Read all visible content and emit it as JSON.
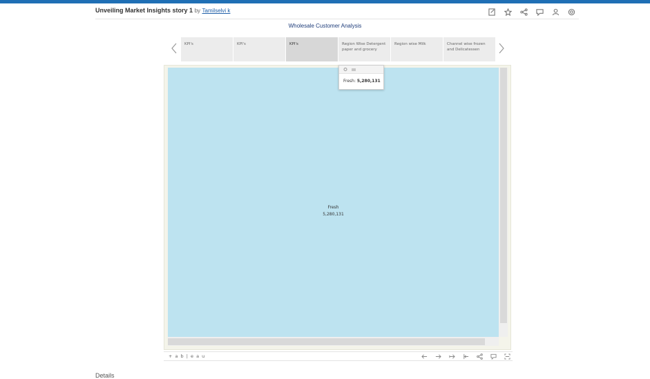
{
  "header": {
    "title": "Unveiling Market Insights story 1",
    "by": "by",
    "author": "Tamilselvi k",
    "actions": [
      "edit-icon",
      "star-icon",
      "share-icon",
      "comment-icon",
      "subscribe-icon",
      "settings-icon"
    ]
  },
  "story": {
    "title": "Wholesale Customer Analysis",
    "tabs": [
      {
        "label": "KPI's"
      },
      {
        "label": "KPI's"
      },
      {
        "label": "KPI's"
      },
      {
        "label": "Region Wise Detergent paper and grocery"
      },
      {
        "label": "Region wise Milk"
      },
      {
        "label": "Channel wise frozen and Delicatessen"
      }
    ],
    "active_tab": 2
  },
  "tooltip": {
    "label": "Fresh:",
    "value": "5,280,131"
  },
  "treemap": {
    "category": "Fresh",
    "value": "5,280,131",
    "color": "#bde3f0"
  },
  "toolbar": {
    "brand": "+ a b | e a u",
    "icons": [
      "undo-icon",
      "redo-icon",
      "revert-icon",
      "first-icon",
      "share-icon",
      "comment-icon",
      "fullscreen-icon"
    ]
  },
  "footer": {
    "details": "Details"
  },
  "colors": {
    "topbar": "#1f6fb5",
    "story_title": "#1f3d7a"
  }
}
